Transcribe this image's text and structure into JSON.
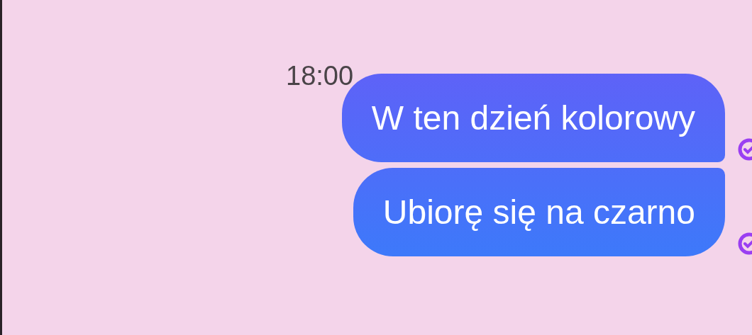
{
  "time": "18:00",
  "messages": [
    {
      "text": "W ten dzień kolorowy",
      "read": true
    },
    {
      "text": "Ubiorę się na czarno",
      "read": true
    }
  ]
}
